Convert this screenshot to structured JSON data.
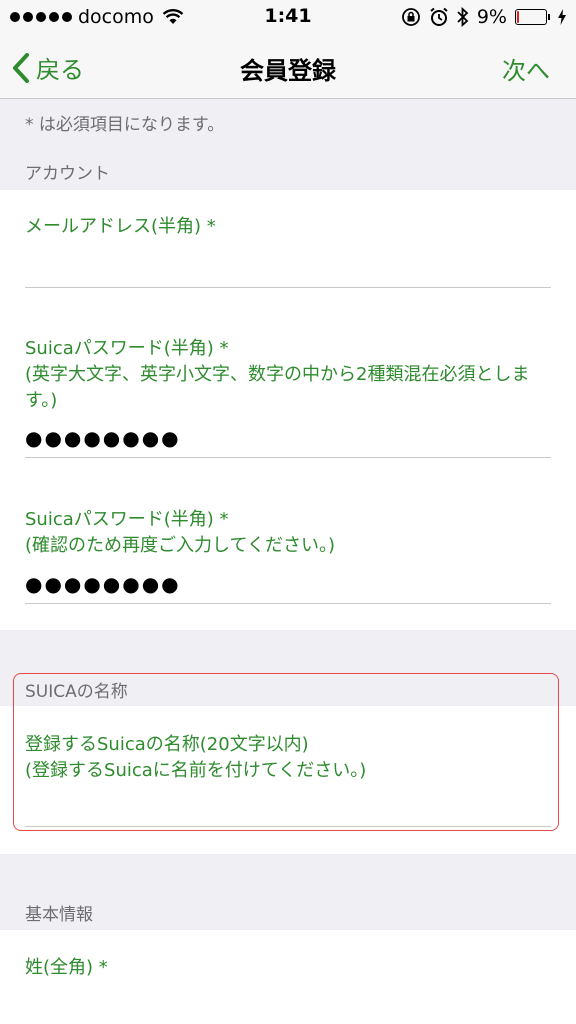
{
  "status_bar": {
    "carrier": "docomo",
    "time": "1:41",
    "battery": "9%",
    "battery_level": 0.09,
    "icons": [
      "wifi-icon",
      "rotation-lock-icon",
      "alarm-icon",
      "bluetooth-icon",
      "battery-icon",
      "charging-icon"
    ]
  },
  "nav": {
    "back_label": "戻る",
    "title": "会員登録",
    "next_label": "次へ"
  },
  "form": {
    "note": "* は必須項目になります。",
    "account": {
      "header": "アカウント",
      "email_label": "メールアドレス(半角) *",
      "email_value": "",
      "password_label_1": "Suicaパスワード(半角) *",
      "password_hint_1": "(英字大文字、英字小文字、数字の中から2種類混在必須とします。)",
      "password_value": "●●●●●●●●",
      "password_label_2": "Suicaパスワード(半角) *",
      "password_hint_2": "(確認のため再度ご入力してください。)",
      "password_confirm_value": "●●●●●●●●"
    },
    "suica_name": {
      "header": "SUICAの名称",
      "label": "登録するSuicaの名称(20文字以内)",
      "hint": "(登録するSuicaに名前を付けてください。)",
      "value": ""
    },
    "basic_info": {
      "header": "基本情報",
      "surname_label": "姓(全角) *"
    }
  },
  "colors": {
    "accent": "#2e8b2e",
    "highlight": "#e84a4a",
    "background": "#efeff4"
  }
}
